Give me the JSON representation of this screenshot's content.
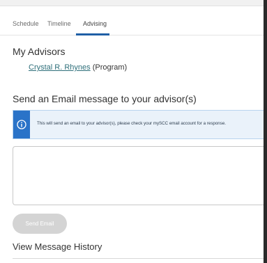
{
  "tabs": [
    {
      "label": "Schedule",
      "active": false
    },
    {
      "label": "Timeline",
      "active": false
    },
    {
      "label": "Advising",
      "active": true
    }
  ],
  "advisors": {
    "heading": "My Advisors",
    "items": [
      {
        "name": "Crystal R. Rhynes",
        "role": "(Program)"
      }
    ]
  },
  "email": {
    "heading": "Send an Email message to your advisor(s)",
    "info_icon": "info-icon",
    "info_text": "This will send an email to your advisor(s), please check your mySCC email account for a response.",
    "message_value": "",
    "send_label": "Send Email",
    "send_enabled": false
  },
  "history": {
    "heading": "View Message History"
  },
  "colors": {
    "accent": "#1f5fa6",
    "info_icon_bg": "#2a73c8",
    "info_bg": "#eaf2fa",
    "link": "#2e6f7a",
    "button_disabled": "#d4d4d4"
  }
}
